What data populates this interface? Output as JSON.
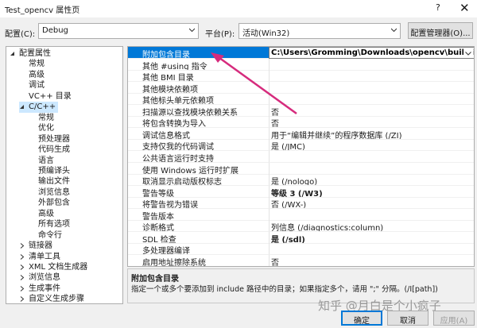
{
  "window": {
    "title": "Test_opencv 属性页",
    "help": "?",
    "close": "✕"
  },
  "config_bar": {
    "config_label": "配置(C):",
    "config_value": "Debug",
    "platform_label": "平台(P):",
    "platform_value": "活动(Win32)",
    "manager_button": "配置管理器(O)..."
  },
  "tree": [
    {
      "label": "配置属性",
      "level": 0,
      "expanded": true
    },
    {
      "label": "常规",
      "level": 1
    },
    {
      "label": "高级",
      "level": 1
    },
    {
      "label": "调试",
      "level": 1
    },
    {
      "label": "VC++ 目录",
      "level": 1
    },
    {
      "label": "C/C++",
      "level": 1,
      "expanded": true,
      "selected": true
    },
    {
      "label": "常规",
      "level": 2
    },
    {
      "label": "优化",
      "level": 2
    },
    {
      "label": "预处理器",
      "level": 2
    },
    {
      "label": "代码生成",
      "level": 2
    },
    {
      "label": "语言",
      "level": 2
    },
    {
      "label": "预编译头",
      "level": 2
    },
    {
      "label": "输出文件",
      "level": 2
    },
    {
      "label": "浏览信息",
      "level": 2
    },
    {
      "label": "外部包含",
      "level": 2
    },
    {
      "label": "高级",
      "level": 2
    },
    {
      "label": "所有选项",
      "level": 2
    },
    {
      "label": "命令行",
      "level": 2
    },
    {
      "label": "链接器",
      "level": 1,
      "collapsed": true
    },
    {
      "label": "清单工具",
      "level": 1,
      "collapsed": true
    },
    {
      "label": "XML 文档生成器",
      "level": 1,
      "collapsed": true
    },
    {
      "label": "浏览信息",
      "level": 1,
      "collapsed": true
    },
    {
      "label": "生成事件",
      "level": 1,
      "collapsed": true
    },
    {
      "label": "自定义生成步骤",
      "level": 1,
      "collapsed": true
    }
  ],
  "properties": [
    {
      "name": "附加包含目录",
      "value": "C:\\Users\\Gromming\\Downloads\\opencv\\build\\include",
      "selected": true
    },
    {
      "name": "其他 #using 指令",
      "value": ""
    },
    {
      "name": "其他 BMI 目录",
      "value": ""
    },
    {
      "name": "其他模块依赖项",
      "value": ""
    },
    {
      "name": "其他标头单元依赖项",
      "value": ""
    },
    {
      "name": "扫描源以查找模块依赖关系",
      "value": "否"
    },
    {
      "name": "将包含转换为导入",
      "value": "否"
    },
    {
      "name": "调试信息格式",
      "value": "用于“编辑并继续”的程序数据库 (/ZI)"
    },
    {
      "name": "支持仅我的代码调试",
      "value": "是 (/JMC)"
    },
    {
      "name": "公共语言运行时支持",
      "value": ""
    },
    {
      "name": "使用 Windows 运行时扩展",
      "value": ""
    },
    {
      "name": "取消显示启动版权标志",
      "value": "是 (/nologo)"
    },
    {
      "name": "警告等级",
      "value": "等级 3 (/W3)",
      "bold": true
    },
    {
      "name": "将警告视为错误",
      "value": "否 (/WX-)"
    },
    {
      "name": "警告版本",
      "value": ""
    },
    {
      "name": "诊断格式",
      "value": "列信息 (/diagnostics:column)"
    },
    {
      "name": "SDL 检查",
      "value": "是 (/sdl)",
      "bold": true
    },
    {
      "name": "多处理器编译",
      "value": ""
    },
    {
      "name": "启用地址擦除系统",
      "value": "否"
    }
  ],
  "description": {
    "title": "附加包含目录",
    "text": "指定一个或多个要添加到 include 路径中的目录；如果指定多个，请用 \";\" 分隔。(/I[path])"
  },
  "buttons": {
    "ok": "确定",
    "cancel": "取消",
    "apply": "应用(A)"
  },
  "watermark": "知乎 @月白是个小疯子",
  "colors": {
    "selection": "#0078d7",
    "tree_selection": "#cce8ff",
    "annotation_arrow": "#d62b7d"
  }
}
